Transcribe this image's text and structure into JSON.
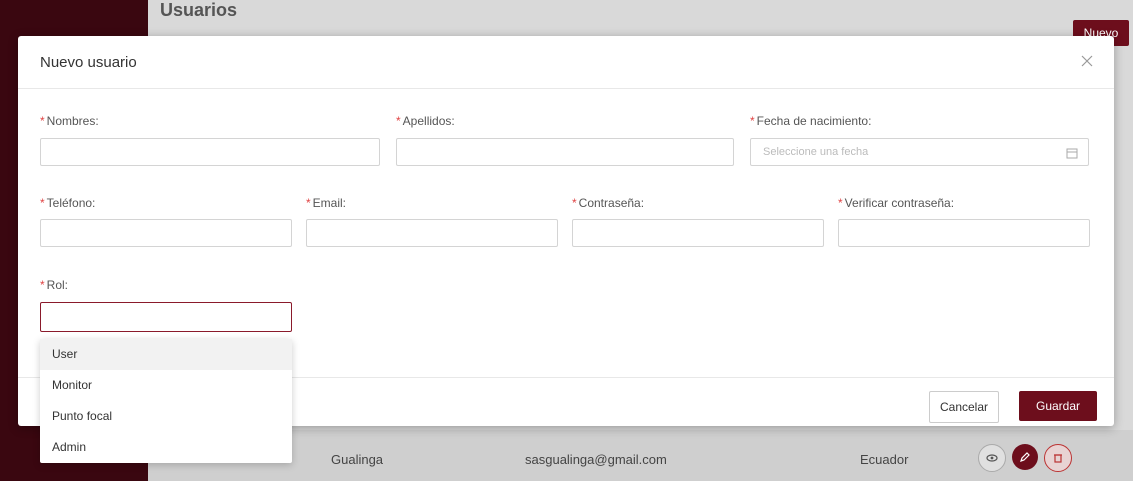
{
  "background": {
    "page_title": "Usuarios",
    "new_button": "Nuevo",
    "row": {
      "apellido": "Gualinga",
      "email": "sasgualinga@gmail.com",
      "pais": "Ecuador"
    }
  },
  "modal": {
    "title": "Nuevo usuario",
    "fields": {
      "nombres": "Nombres:",
      "apellidos": "Apellidos:",
      "fecha": "Fecha de nacimiento:",
      "fecha_placeholder": "Seleccione una fecha",
      "telefono": "Teléfono:",
      "email": "Email:",
      "contrasena": "Contraseña:",
      "verificar": "Verificar contraseña:",
      "rol": "Rol:"
    },
    "required_mark": "*",
    "rol_options": [
      "User",
      "Monitor",
      "Punto focal",
      "Admin"
    ],
    "cancel_label": "Cancelar",
    "save_label": "Guardar"
  },
  "colors": {
    "accent": "#6d0e1c",
    "required": "#e04444"
  }
}
